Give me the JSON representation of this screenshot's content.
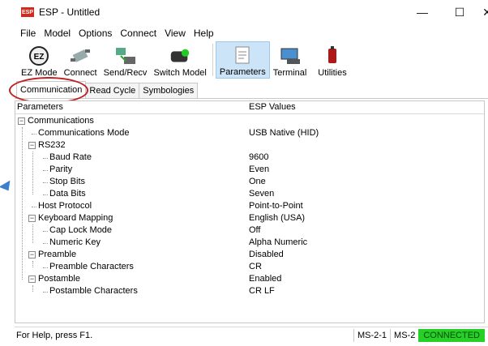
{
  "window": {
    "title": "ESP - Untitled",
    "icon": "ESP",
    "controls": {
      "minimize": "—",
      "maximize": "☐",
      "close": "✕"
    }
  },
  "menu": [
    "File",
    "Model",
    "Options",
    "Connect",
    "View",
    "Help"
  ],
  "toolbar": {
    "buttons": [
      {
        "label": "EZ Mode",
        "icon": "ez-mode-icon"
      },
      {
        "label": "Connect",
        "icon": "connect-icon"
      },
      {
        "label": "Send/Recv",
        "icon": "send-recv-icon"
      },
      {
        "label": "Switch Model",
        "icon": "switch-model-icon"
      },
      {
        "label": "Parameters",
        "icon": "parameters-icon",
        "active": true
      },
      {
        "label": "Terminal",
        "icon": "terminal-icon"
      },
      {
        "label": "Utilities",
        "icon": "utilities-icon"
      }
    ]
  },
  "tabs": [
    {
      "label": "Communication",
      "active": true
    },
    {
      "label": "Read Cycle",
      "active": false
    },
    {
      "label": "Symbologies",
      "active": false
    }
  ],
  "grid": {
    "col_param": "Parameters",
    "col_value": "ESP Values",
    "rows": [
      {
        "label": "Communications",
        "value": "",
        "level": 0,
        "expander": true
      },
      {
        "label": "Communications Mode",
        "value": "USB Native (HID)",
        "level": 1
      },
      {
        "label": "RS232",
        "value": "",
        "level": 1,
        "expander": true
      },
      {
        "label": "Baud Rate",
        "value": "9600",
        "level": 2
      },
      {
        "label": "Parity",
        "value": "Even",
        "level": 2
      },
      {
        "label": "Stop Bits",
        "value": "One",
        "level": 2
      },
      {
        "label": "Data Bits",
        "value": "Seven",
        "level": 2
      },
      {
        "label": "Host Protocol",
        "value": "Point-to-Point",
        "level": 1
      },
      {
        "label": "Keyboard Mapping",
        "value": "English (USA)",
        "level": 1,
        "expander": true
      },
      {
        "label": "Cap Lock Mode",
        "value": "Off",
        "level": 2
      },
      {
        "label": "Numeric Key",
        "value": "Alpha Numeric",
        "level": 2
      },
      {
        "label": "Preamble",
        "value": "Disabled",
        "level": 1,
        "expander": true
      },
      {
        "label": "Preamble Characters",
        "value": " CR",
        "level": 2
      },
      {
        "label": "Postamble",
        "value": "Enabled",
        "level": 1,
        "expander": true
      },
      {
        "label": "Postamble Characters",
        "value": " CR LF",
        "level": 2
      }
    ]
  },
  "status": {
    "help": "For Help, press F1.",
    "model1": "MS-2-1",
    "model2": "MS-2",
    "connection": "CONNECTED"
  },
  "colors": {
    "connected": "#26d026",
    "highlight_circle": "#c02020",
    "active_tool": "#cce4f7"
  }
}
